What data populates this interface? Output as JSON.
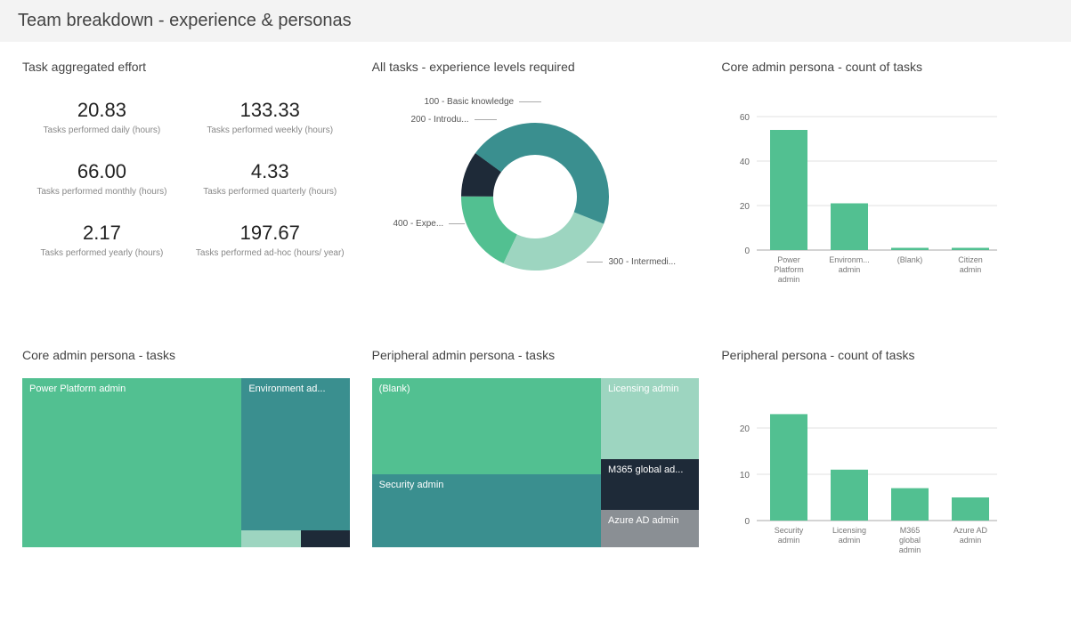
{
  "header": {
    "title": "Team breakdown - experience & personas"
  },
  "kpi": {
    "title": "Task aggregated effort",
    "cells": [
      {
        "value": "20.83",
        "label": "Tasks performed daily (hours)"
      },
      {
        "value": "133.33",
        "label": "Tasks performed weekly (hours)"
      },
      {
        "value": "66.00",
        "label": "Tasks performed monthly (hours)"
      },
      {
        "value": "4.33",
        "label": "Tasks performed quarterly (hours)"
      },
      {
        "value": "2.17",
        "label": "Tasks performed yearly (hours)"
      },
      {
        "value": "197.67",
        "label": "Tasks performed ad-hoc (hours/ year)"
      }
    ]
  },
  "donut": {
    "title": "All tasks - experience levels required",
    "labels": {
      "l100": "100 - Basic knowledge",
      "l200": "200 - Introdu...",
      "l300": "300 - Intermedi...",
      "l400": "400 - Expe..."
    }
  },
  "coreBar": {
    "title": "Core admin persona - count of tasks",
    "cats": [
      "Power Platform admin",
      "Environm... admin",
      "(Blank)",
      "Citizen admin"
    ]
  },
  "periphBar": {
    "title": "Peripheral persona - count of tasks",
    "cats": [
      "Security admin",
      "Licensing admin",
      "M365 global admin",
      "Azure AD admin"
    ]
  },
  "coreTree": {
    "title": "Core admin persona - tasks",
    "labels": {
      "ppa": "Power Platform admin",
      "env": "Environment ad..."
    }
  },
  "periphTree": {
    "title": "Peripheral admin persona - tasks",
    "labels": {
      "blank": "(Blank)",
      "sec": "Security admin",
      "lic": "Licensing admin",
      "m365": "M365 global ad...",
      "aad": "Azure AD admin"
    }
  },
  "colors": {
    "teal": "#3a8f8f",
    "green": "#52c091",
    "mint": "#9dd5c0",
    "dark": "#1e2a38",
    "grey": "#8a8f94"
  },
  "chart_data": [
    {
      "type": "table",
      "title": "Task aggregated effort",
      "data": [
        {
          "metric": "Tasks performed daily (hours)",
          "value": 20.83
        },
        {
          "metric": "Tasks performed weekly (hours)",
          "value": 133.33
        },
        {
          "metric": "Tasks performed monthly (hours)",
          "value": 66.0
        },
        {
          "metric": "Tasks performed quarterly (hours)",
          "value": 4.33
        },
        {
          "metric": "Tasks performed yearly (hours)",
          "value": 2.17
        },
        {
          "metric": "Tasks performed ad-hoc (hours/ year)",
          "value": 197.67
        }
      ]
    },
    {
      "type": "pie",
      "title": "All tasks - experience levels required",
      "subtype": "donut",
      "categories": [
        "300 - Intermediate",
        "400 - Expert",
        "200 - Introductory",
        "100 - Basic knowledge"
      ],
      "values": [
        46,
        26,
        18,
        10
      ],
      "colors": [
        "#3a8f8f",
        "#9dd5c0",
        "#52c091",
        "#1e2a38"
      ]
    },
    {
      "type": "bar",
      "title": "Core admin persona - count of tasks",
      "categories": [
        "Power Platform admin",
        "Environment admin",
        "(Blank)",
        "Citizen admin"
      ],
      "values": [
        54,
        21,
        1,
        1
      ],
      "xlabel": "",
      "ylabel": "",
      "ylim": [
        0,
        60
      ]
    },
    {
      "type": "bar",
      "title": "Peripheral persona - count of tasks",
      "categories": [
        "Security admin",
        "Licensing admin",
        "M365 global admin",
        "Azure AD admin"
      ],
      "values": [
        23,
        11,
        7,
        5
      ],
      "xlabel": "",
      "ylabel": "",
      "ylim": [
        0,
        25
      ]
    },
    {
      "type": "treemap",
      "title": "Core admin persona - tasks",
      "categories": [
        "Power Platform admin",
        "Environment admin",
        "(Blank)",
        "Citizen admin"
      ],
      "values": [
        54,
        21,
        1,
        1
      ],
      "colors": [
        "#52c091",
        "#3a8f8f",
        "#9dd5c0",
        "#1e2a38"
      ]
    },
    {
      "type": "treemap",
      "title": "Peripheral admin persona - tasks",
      "categories": [
        "(Blank)",
        "Security admin",
        "Licensing admin",
        "M365 global admin",
        "Azure AD admin"
      ],
      "values": [
        31,
        23,
        11,
        7,
        5
      ],
      "colors": [
        "#52c091",
        "#3a8f8f",
        "#9dd5c0",
        "#1e2a38",
        "#8a8f94"
      ]
    }
  ]
}
